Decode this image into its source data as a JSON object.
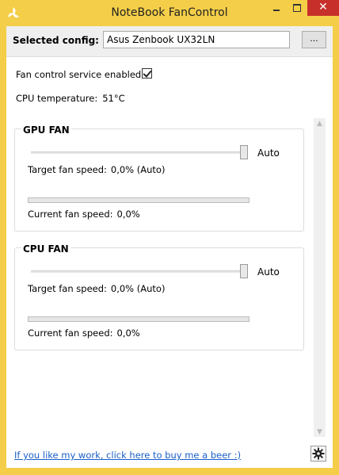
{
  "window": {
    "title": "NoteBook FanControl",
    "close_glyph": "✕"
  },
  "config": {
    "label": "Selected config:",
    "value": "Asus Zenbook UX32LN",
    "browse_label": "..."
  },
  "service": {
    "label": "Fan control service enabled:",
    "enabled": true
  },
  "temperature": {
    "label": "CPU temperature:",
    "value": "51°C"
  },
  "fans": [
    {
      "name": "GPU FAN",
      "auto_label": "Auto",
      "target_label": "Target fan speed:",
      "target_value": "0,0% (Auto)",
      "current_label": "Current fan speed:",
      "current_value": "0,0%",
      "current_fraction": 0.0,
      "slider_position": "max"
    },
    {
      "name": "CPU FAN",
      "auto_label": "Auto",
      "target_label": "Target fan speed:",
      "target_value": "0,0% (Auto)",
      "current_label": "Current fan speed:",
      "current_value": "0,0%",
      "current_fraction": 0.0,
      "slider_position": "max"
    }
  ],
  "footer": {
    "link_text": "If you like my work, click here to buy me a beer :)"
  },
  "colors": {
    "title_bar": "#f4ce48",
    "close_button": "#c7302a",
    "link": "#1a5fc8"
  },
  "icons": [
    "app-fan-icon",
    "minimize-icon",
    "maximize-icon",
    "close-icon",
    "scroll-up-icon",
    "scroll-down-icon",
    "gear-icon"
  ]
}
